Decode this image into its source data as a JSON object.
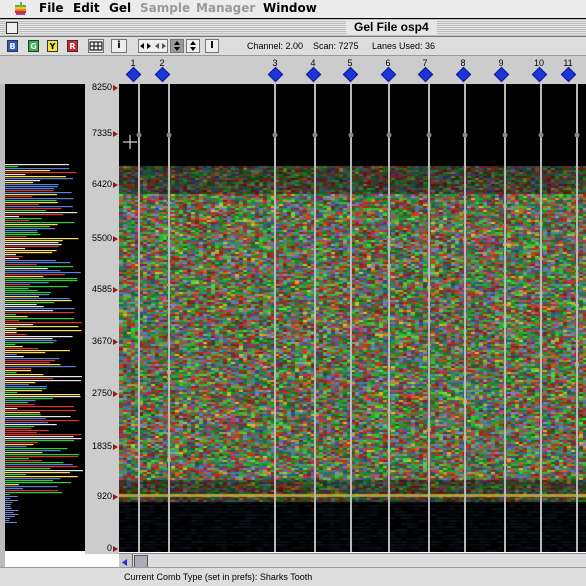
{
  "menubar": {
    "items": [
      {
        "label": "File",
        "enabled": true
      },
      {
        "label": "Edit",
        "enabled": true
      },
      {
        "label": "Gel",
        "enabled": true
      },
      {
        "label": "Sample",
        "enabled": false
      },
      {
        "label": "Manager",
        "enabled": false
      },
      {
        "label": "Window",
        "enabled": true
      }
    ]
  },
  "window": {
    "title": "Gel File osp4"
  },
  "toolbar": {
    "color_buttons": [
      {
        "label": "B",
        "color": "#2a55d8"
      },
      {
        "label": "G",
        "color": "#29b34a"
      },
      {
        "label": "Y",
        "color": "#f2e23a"
      },
      {
        "label": "R",
        "color": "#d8232a"
      }
    ],
    "channel": "Channel: 2.00",
    "scan": "Scan: 7275",
    "lanes_used": "Lanes Used: 36"
  },
  "lanes": [
    "1",
    "2",
    "3",
    "4",
    "5",
    "6",
    "7",
    "8",
    "9",
    "10",
    "11"
  ],
  "y_axis": {
    "ticks": [
      "8250",
      "7335",
      "6420",
      "5500",
      "4585",
      "3670",
      "2750",
      "1835",
      "920",
      "0"
    ]
  },
  "status": {
    "text": "Current Comb Type (set in prefs): Sharks Tooth"
  },
  "colors": {
    "lane_marker": "#1c35d6",
    "tick_marker": "#8b1a1a",
    "background_panel": "#cccccc"
  }
}
